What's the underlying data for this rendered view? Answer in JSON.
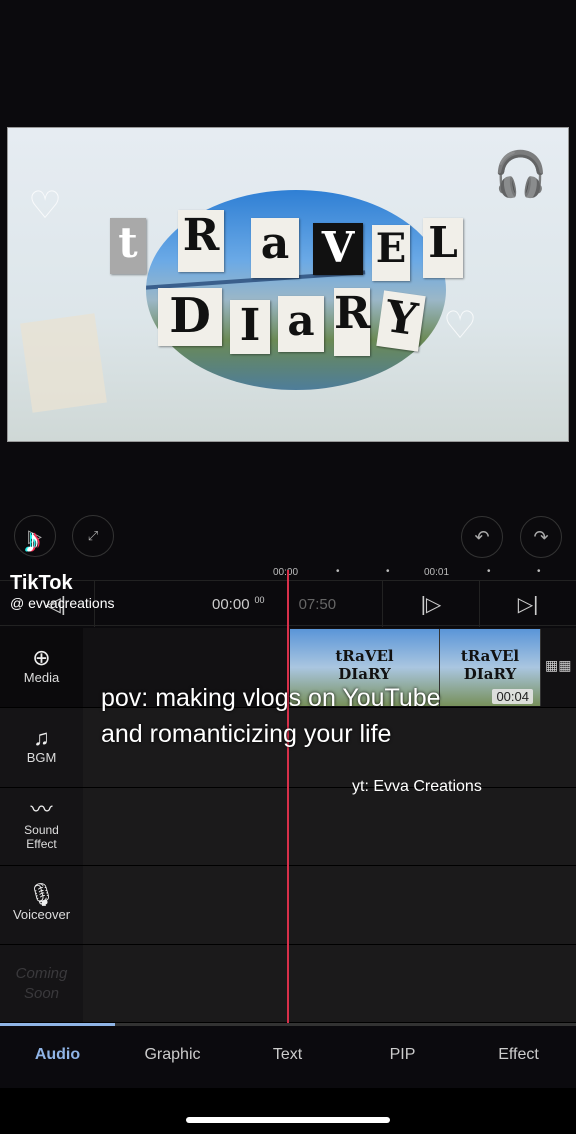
{
  "preview": {
    "title_line1": [
      "t",
      "R",
      "a",
      "V",
      "E",
      "L"
    ],
    "title_line2": [
      "D",
      "I",
      "a",
      "R",
      "Y"
    ]
  },
  "controls": {
    "play": "play-icon",
    "fullscreen": "fullscreen-icon",
    "undo": "undo-icon",
    "redo": "redo-icon"
  },
  "ruler": {
    "start": "00:00",
    "mark": "00:01"
  },
  "transport": {
    "current_time": "00:00",
    "current_frames": "00",
    "total_time": "07:50"
  },
  "tracks": [
    {
      "label": "Media"
    },
    {
      "label": "BGM"
    },
    {
      "label": "Sound Effect"
    },
    {
      "label": "Voiceover"
    },
    {
      "label": "Coming Soon"
    }
  ],
  "clip": {
    "duration": "00:04",
    "thumb_line1": "tRaVEl",
    "thumb_line2": "DIaRY"
  },
  "overlay": {
    "caption": "pov: making vlogs on YouTube and romanticizing your life",
    "credit": "yt: Evva Creations",
    "tiktok_brand": "TikTok",
    "tiktok_handle": "@ evvacreations"
  },
  "tabs": [
    {
      "label": "Audio",
      "active": true
    },
    {
      "label": "Graphic"
    },
    {
      "label": "Text"
    },
    {
      "label": "PIP"
    },
    {
      "label": "Effect"
    }
  ],
  "colors": {
    "accent": "#8fb4e6",
    "playhead": "#d8304a"
  }
}
